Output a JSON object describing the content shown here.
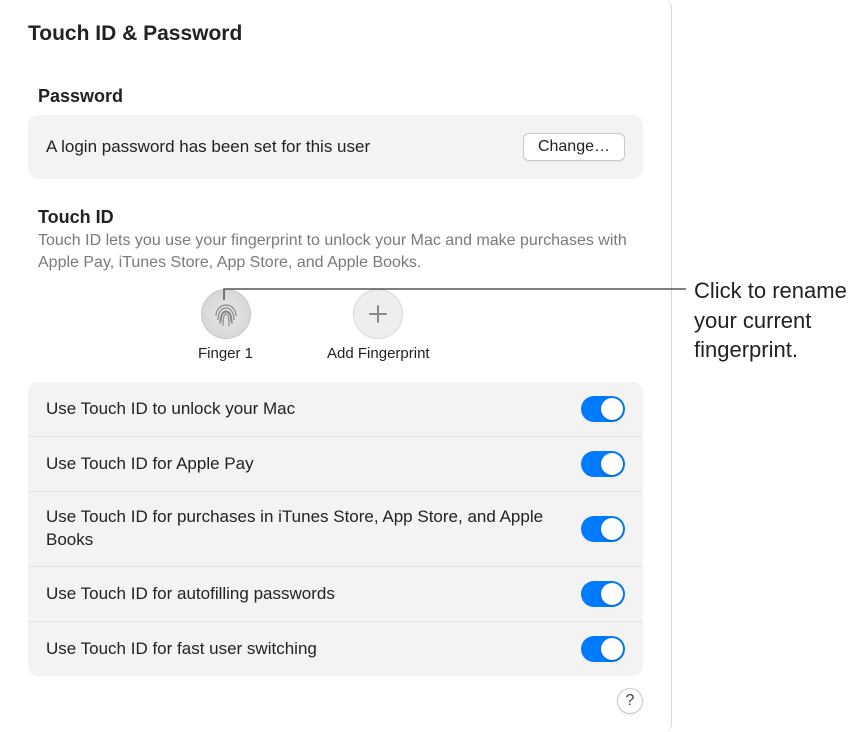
{
  "title": "Touch ID & Password",
  "password_section": {
    "label": "Password",
    "status": "A login password has been set for this user",
    "change_button": "Change…"
  },
  "touchid_section": {
    "label": "Touch ID",
    "description": "Touch ID lets you use your fingerprint to unlock your Mac and make purchases with Apple Pay, iTunes Store, App Store, and Apple Books.",
    "fingerprints": [
      {
        "label": "Finger 1"
      }
    ],
    "add_label": "Add Fingerprint"
  },
  "settings": [
    {
      "label": "Use Touch ID to unlock your Mac",
      "on": true
    },
    {
      "label": "Use Touch ID for Apple Pay",
      "on": true
    },
    {
      "label": "Use Touch ID for purchases in iTunes Store, App Store, and Apple Books",
      "on": true
    },
    {
      "label": "Use Touch ID for autofilling passwords",
      "on": true
    },
    {
      "label": "Use Touch ID for fast user switching",
      "on": true
    }
  ],
  "help": "?",
  "callout": "Click to rename your current fingerprint."
}
